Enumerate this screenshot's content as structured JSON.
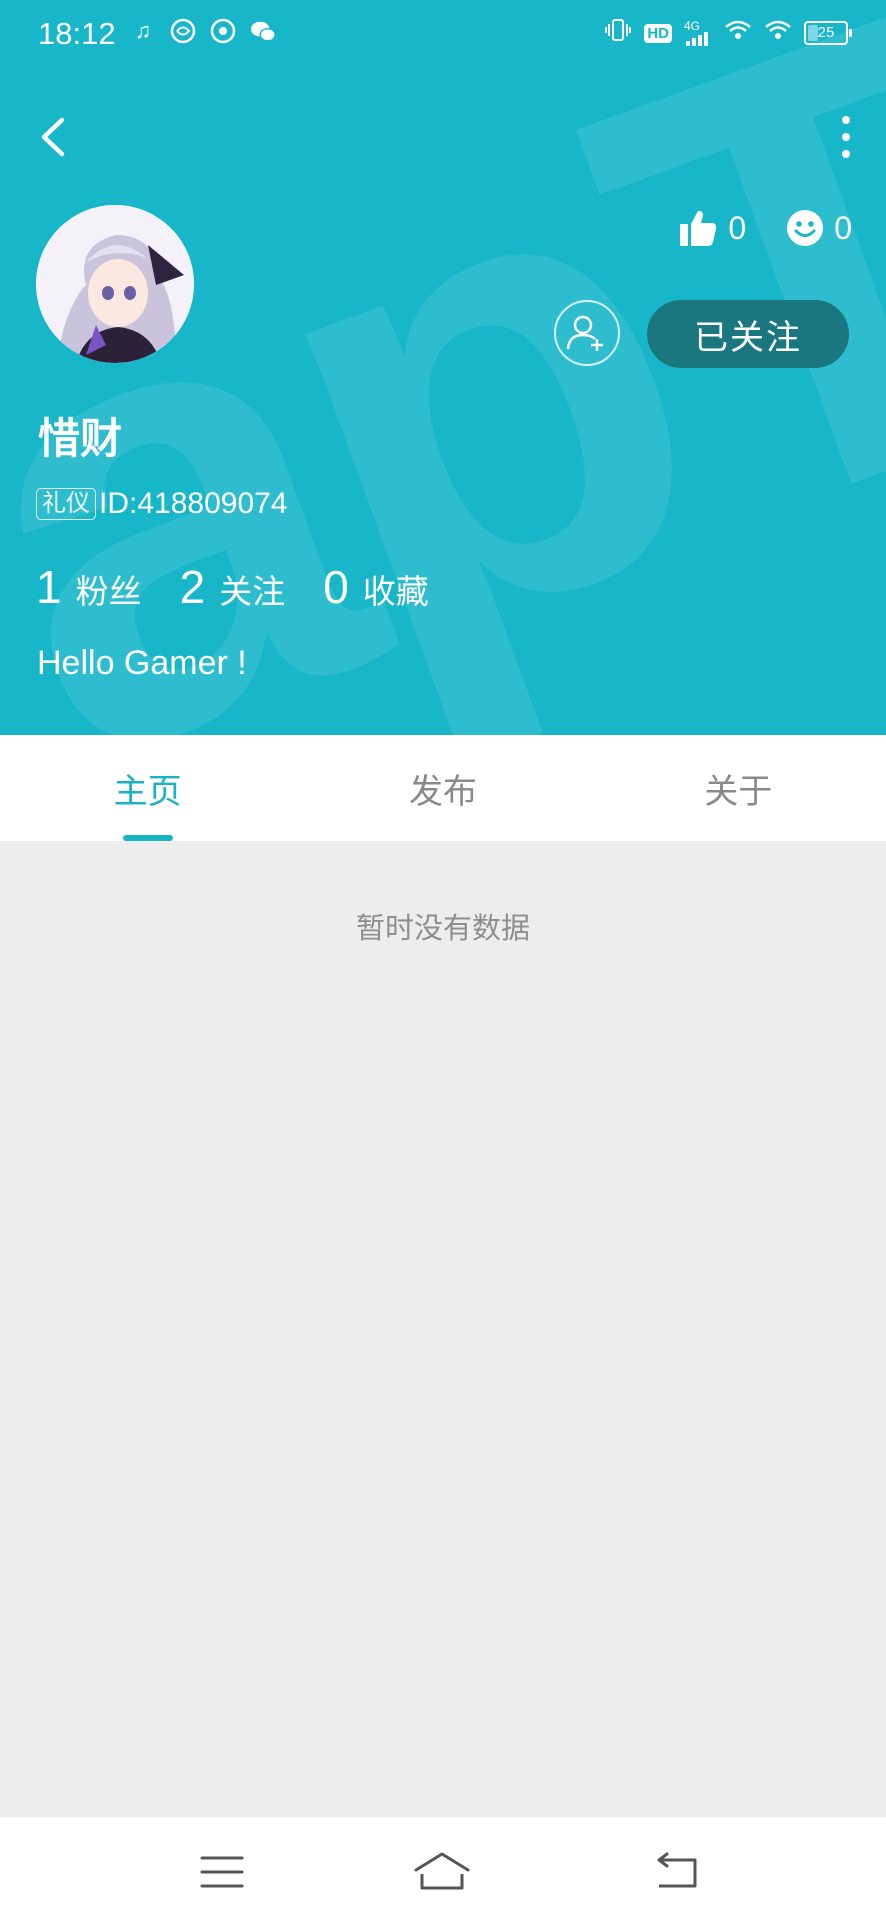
{
  "status_bar": {
    "time": "18:12",
    "battery": "25",
    "network": "4G",
    "hd": "HD"
  },
  "profile": {
    "name": "惜财",
    "tag": "礼仪",
    "id": "ID:418809074",
    "bio": "Hello Gamer !",
    "likes": "0",
    "smiles": "0",
    "follow_label": "已关注",
    "counts": [
      {
        "value": "1",
        "label": "粉丝"
      },
      {
        "value": "2",
        "label": "关注"
      },
      {
        "value": "0",
        "label": "收藏"
      }
    ]
  },
  "tabs": [
    {
      "label": "主页",
      "active": true
    },
    {
      "label": "发布",
      "active": false
    },
    {
      "label": "关于",
      "active": false
    }
  ],
  "main": {
    "empty_text": "暂时没有数据"
  },
  "colors": {
    "accent": "#17b6c9",
    "follow_button": "#1a7780",
    "background": "#ededed"
  }
}
